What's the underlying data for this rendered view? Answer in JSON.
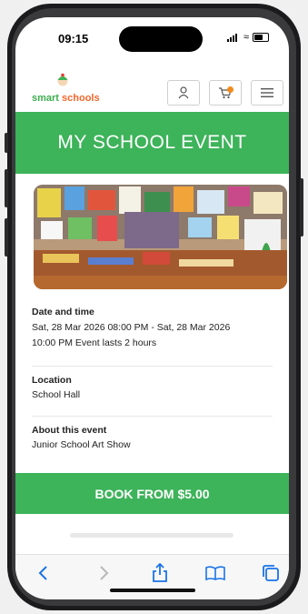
{
  "status_bar": {
    "time": "09:15"
  },
  "header": {
    "logo_text_1": "smart",
    "logo_text_2": "schools",
    "account_icon": "person-icon",
    "cart_icon": "cart-icon",
    "menu_icon": "hamburger-menu-icon"
  },
  "banner": {
    "title": "MY SCHOOL EVENT"
  },
  "event": {
    "date_label": "Date and time",
    "date_line_1": "Sat, 28 Mar 2026 08:00 PM - Sat, 28 Mar 2026",
    "date_line_2": "10:00 PM Event lasts 2 hours",
    "location_label": "Location",
    "location_value": "School Hall",
    "about_label": "About this event",
    "about_value": "Junior School Art Show"
  },
  "cta": {
    "book_label": "BOOK FROM $5.00"
  },
  "browser_toolbar": {
    "icons": [
      "back-icon",
      "forward-icon",
      "share-icon",
      "bookmarks-icon",
      "tabs-icon"
    ]
  },
  "colors": {
    "brand_green": "#3db35a",
    "accent_orange": "#f28a1e",
    "ios_blue": "#1a73e8"
  }
}
